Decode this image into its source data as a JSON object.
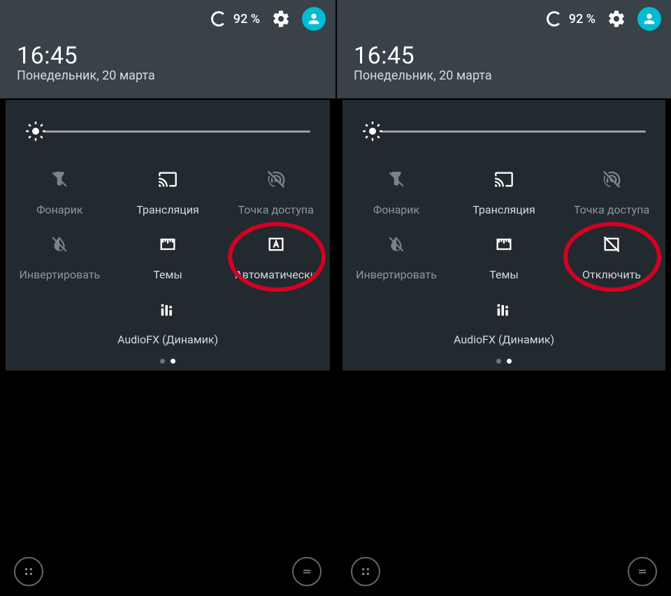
{
  "status": {
    "battery_pct": "92 %"
  },
  "clock": {
    "time": "16:45",
    "date": "Понедельник, 20 марта"
  },
  "tiles": {
    "flashlight": "Фонарик",
    "cast": "Трансляция",
    "hotspot": "Точка доступа",
    "invert": "Инвертировать",
    "themes": "Темы",
    "keyboard_left": "Автоматически",
    "keyboard_right": "Отключить",
    "audiofx": "AudioFX (Динамик)"
  }
}
